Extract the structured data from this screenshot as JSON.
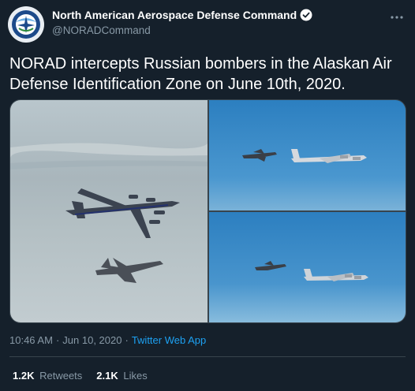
{
  "tweet": {
    "display_name": "North American Aerospace Defense Command",
    "handle": "@NORADCommand",
    "text": "NORAD intercepts Russian bombers in the Alaskan Air Defense Identification Zone on June 10th, 2020.",
    "time": "10:46 AM",
    "date": "Jun 10, 2020",
    "separator": "·",
    "source": "Twitter Web App",
    "retweets_count": "1.2K",
    "retweets_label": "Retweets",
    "likes_count": "2.1K",
    "likes_label": "Likes"
  },
  "icons": {
    "avatar": "norad-seal-icon",
    "verified": "verified-badge-icon",
    "more": "more-options-icon"
  },
  "colors": {
    "background": "#15202b",
    "muted_text": "#8899a6",
    "link": "#1da1f2",
    "border": "#38444d"
  }
}
